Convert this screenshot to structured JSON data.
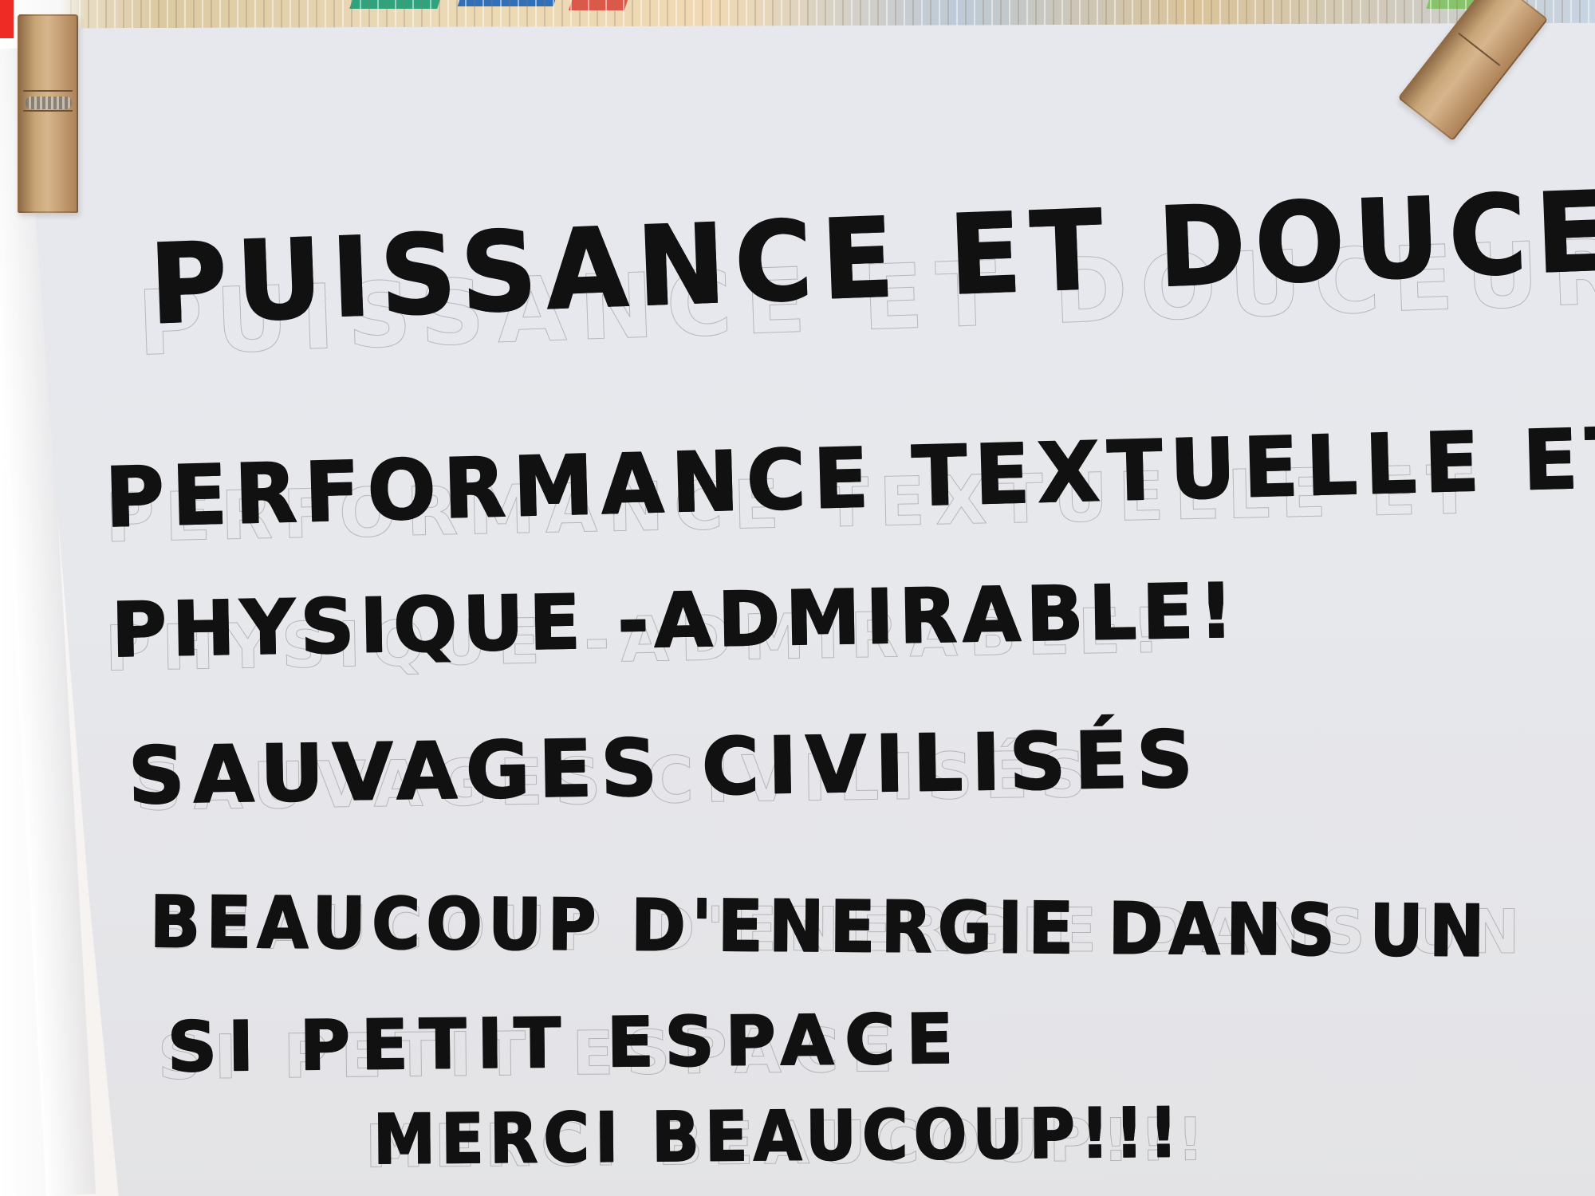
{
  "note": {
    "lines": [
      "PUISSANCE ET DOUCEUR",
      "PERFORMANCE TEXTUELLE ET",
      "PHYSIQUE -ADMIRABLE!",
      "SAUVAGES CIVILISÉS",
      "BEAUCOUP D'ENERGIE DANS UN",
      "SI PETIT ESPACE",
      "MERCI BEAUCOUP!!!"
    ]
  },
  "colors": {
    "paper": "#e6e8ee",
    "ink": "#111111",
    "clothespin": "#c9a678",
    "background": "#f3f0ee"
  }
}
